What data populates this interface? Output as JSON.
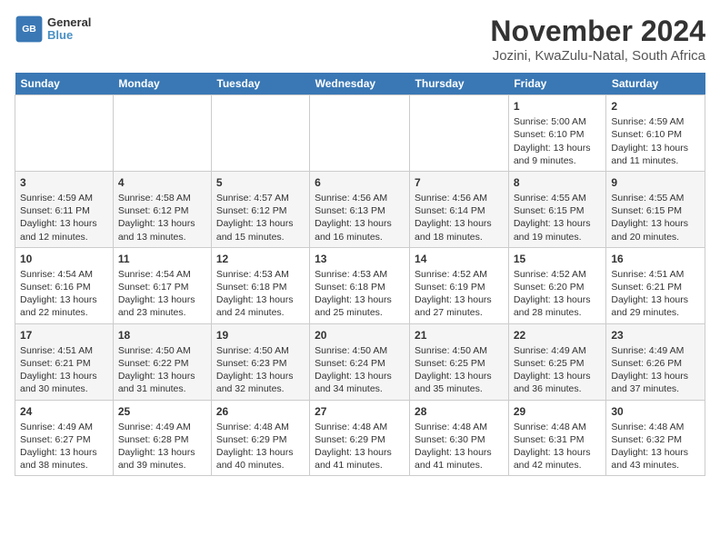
{
  "logo": {
    "line1": "General",
    "line2": "Blue"
  },
  "title": "November 2024",
  "subtitle": "Jozini, KwaZulu-Natal, South Africa",
  "days_of_week": [
    "Sunday",
    "Monday",
    "Tuesday",
    "Wednesday",
    "Thursday",
    "Friday",
    "Saturday"
  ],
  "weeks": [
    [
      {
        "day": "",
        "info": ""
      },
      {
        "day": "",
        "info": ""
      },
      {
        "day": "",
        "info": ""
      },
      {
        "day": "",
        "info": ""
      },
      {
        "day": "",
        "info": ""
      },
      {
        "day": "1",
        "info": "Sunrise: 5:00 AM\nSunset: 6:10 PM\nDaylight: 13 hours and 9 minutes."
      },
      {
        "day": "2",
        "info": "Sunrise: 4:59 AM\nSunset: 6:10 PM\nDaylight: 13 hours and 11 minutes."
      }
    ],
    [
      {
        "day": "3",
        "info": "Sunrise: 4:59 AM\nSunset: 6:11 PM\nDaylight: 13 hours and 12 minutes."
      },
      {
        "day": "4",
        "info": "Sunrise: 4:58 AM\nSunset: 6:12 PM\nDaylight: 13 hours and 13 minutes."
      },
      {
        "day": "5",
        "info": "Sunrise: 4:57 AM\nSunset: 6:12 PM\nDaylight: 13 hours and 15 minutes."
      },
      {
        "day": "6",
        "info": "Sunrise: 4:56 AM\nSunset: 6:13 PM\nDaylight: 13 hours and 16 minutes."
      },
      {
        "day": "7",
        "info": "Sunrise: 4:56 AM\nSunset: 6:14 PM\nDaylight: 13 hours and 18 minutes."
      },
      {
        "day": "8",
        "info": "Sunrise: 4:55 AM\nSunset: 6:15 PM\nDaylight: 13 hours and 19 minutes."
      },
      {
        "day": "9",
        "info": "Sunrise: 4:55 AM\nSunset: 6:15 PM\nDaylight: 13 hours and 20 minutes."
      }
    ],
    [
      {
        "day": "10",
        "info": "Sunrise: 4:54 AM\nSunset: 6:16 PM\nDaylight: 13 hours and 22 minutes."
      },
      {
        "day": "11",
        "info": "Sunrise: 4:54 AM\nSunset: 6:17 PM\nDaylight: 13 hours and 23 minutes."
      },
      {
        "day": "12",
        "info": "Sunrise: 4:53 AM\nSunset: 6:18 PM\nDaylight: 13 hours and 24 minutes."
      },
      {
        "day": "13",
        "info": "Sunrise: 4:53 AM\nSunset: 6:18 PM\nDaylight: 13 hours and 25 minutes."
      },
      {
        "day": "14",
        "info": "Sunrise: 4:52 AM\nSunset: 6:19 PM\nDaylight: 13 hours and 27 minutes."
      },
      {
        "day": "15",
        "info": "Sunrise: 4:52 AM\nSunset: 6:20 PM\nDaylight: 13 hours and 28 minutes."
      },
      {
        "day": "16",
        "info": "Sunrise: 4:51 AM\nSunset: 6:21 PM\nDaylight: 13 hours and 29 minutes."
      }
    ],
    [
      {
        "day": "17",
        "info": "Sunrise: 4:51 AM\nSunset: 6:21 PM\nDaylight: 13 hours and 30 minutes."
      },
      {
        "day": "18",
        "info": "Sunrise: 4:50 AM\nSunset: 6:22 PM\nDaylight: 13 hours and 31 minutes."
      },
      {
        "day": "19",
        "info": "Sunrise: 4:50 AM\nSunset: 6:23 PM\nDaylight: 13 hours and 32 minutes."
      },
      {
        "day": "20",
        "info": "Sunrise: 4:50 AM\nSunset: 6:24 PM\nDaylight: 13 hours and 34 minutes."
      },
      {
        "day": "21",
        "info": "Sunrise: 4:50 AM\nSunset: 6:25 PM\nDaylight: 13 hours and 35 minutes."
      },
      {
        "day": "22",
        "info": "Sunrise: 4:49 AM\nSunset: 6:25 PM\nDaylight: 13 hours and 36 minutes."
      },
      {
        "day": "23",
        "info": "Sunrise: 4:49 AM\nSunset: 6:26 PM\nDaylight: 13 hours and 37 minutes."
      }
    ],
    [
      {
        "day": "24",
        "info": "Sunrise: 4:49 AM\nSunset: 6:27 PM\nDaylight: 13 hours and 38 minutes."
      },
      {
        "day": "25",
        "info": "Sunrise: 4:49 AM\nSunset: 6:28 PM\nDaylight: 13 hours and 39 minutes."
      },
      {
        "day": "26",
        "info": "Sunrise: 4:48 AM\nSunset: 6:29 PM\nDaylight: 13 hours and 40 minutes."
      },
      {
        "day": "27",
        "info": "Sunrise: 4:48 AM\nSunset: 6:29 PM\nDaylight: 13 hours and 41 minutes."
      },
      {
        "day": "28",
        "info": "Sunrise: 4:48 AM\nSunset: 6:30 PM\nDaylight: 13 hours and 41 minutes."
      },
      {
        "day": "29",
        "info": "Sunrise: 4:48 AM\nSunset: 6:31 PM\nDaylight: 13 hours and 42 minutes."
      },
      {
        "day": "30",
        "info": "Sunrise: 4:48 AM\nSunset: 6:32 PM\nDaylight: 13 hours and 43 minutes."
      }
    ]
  ]
}
